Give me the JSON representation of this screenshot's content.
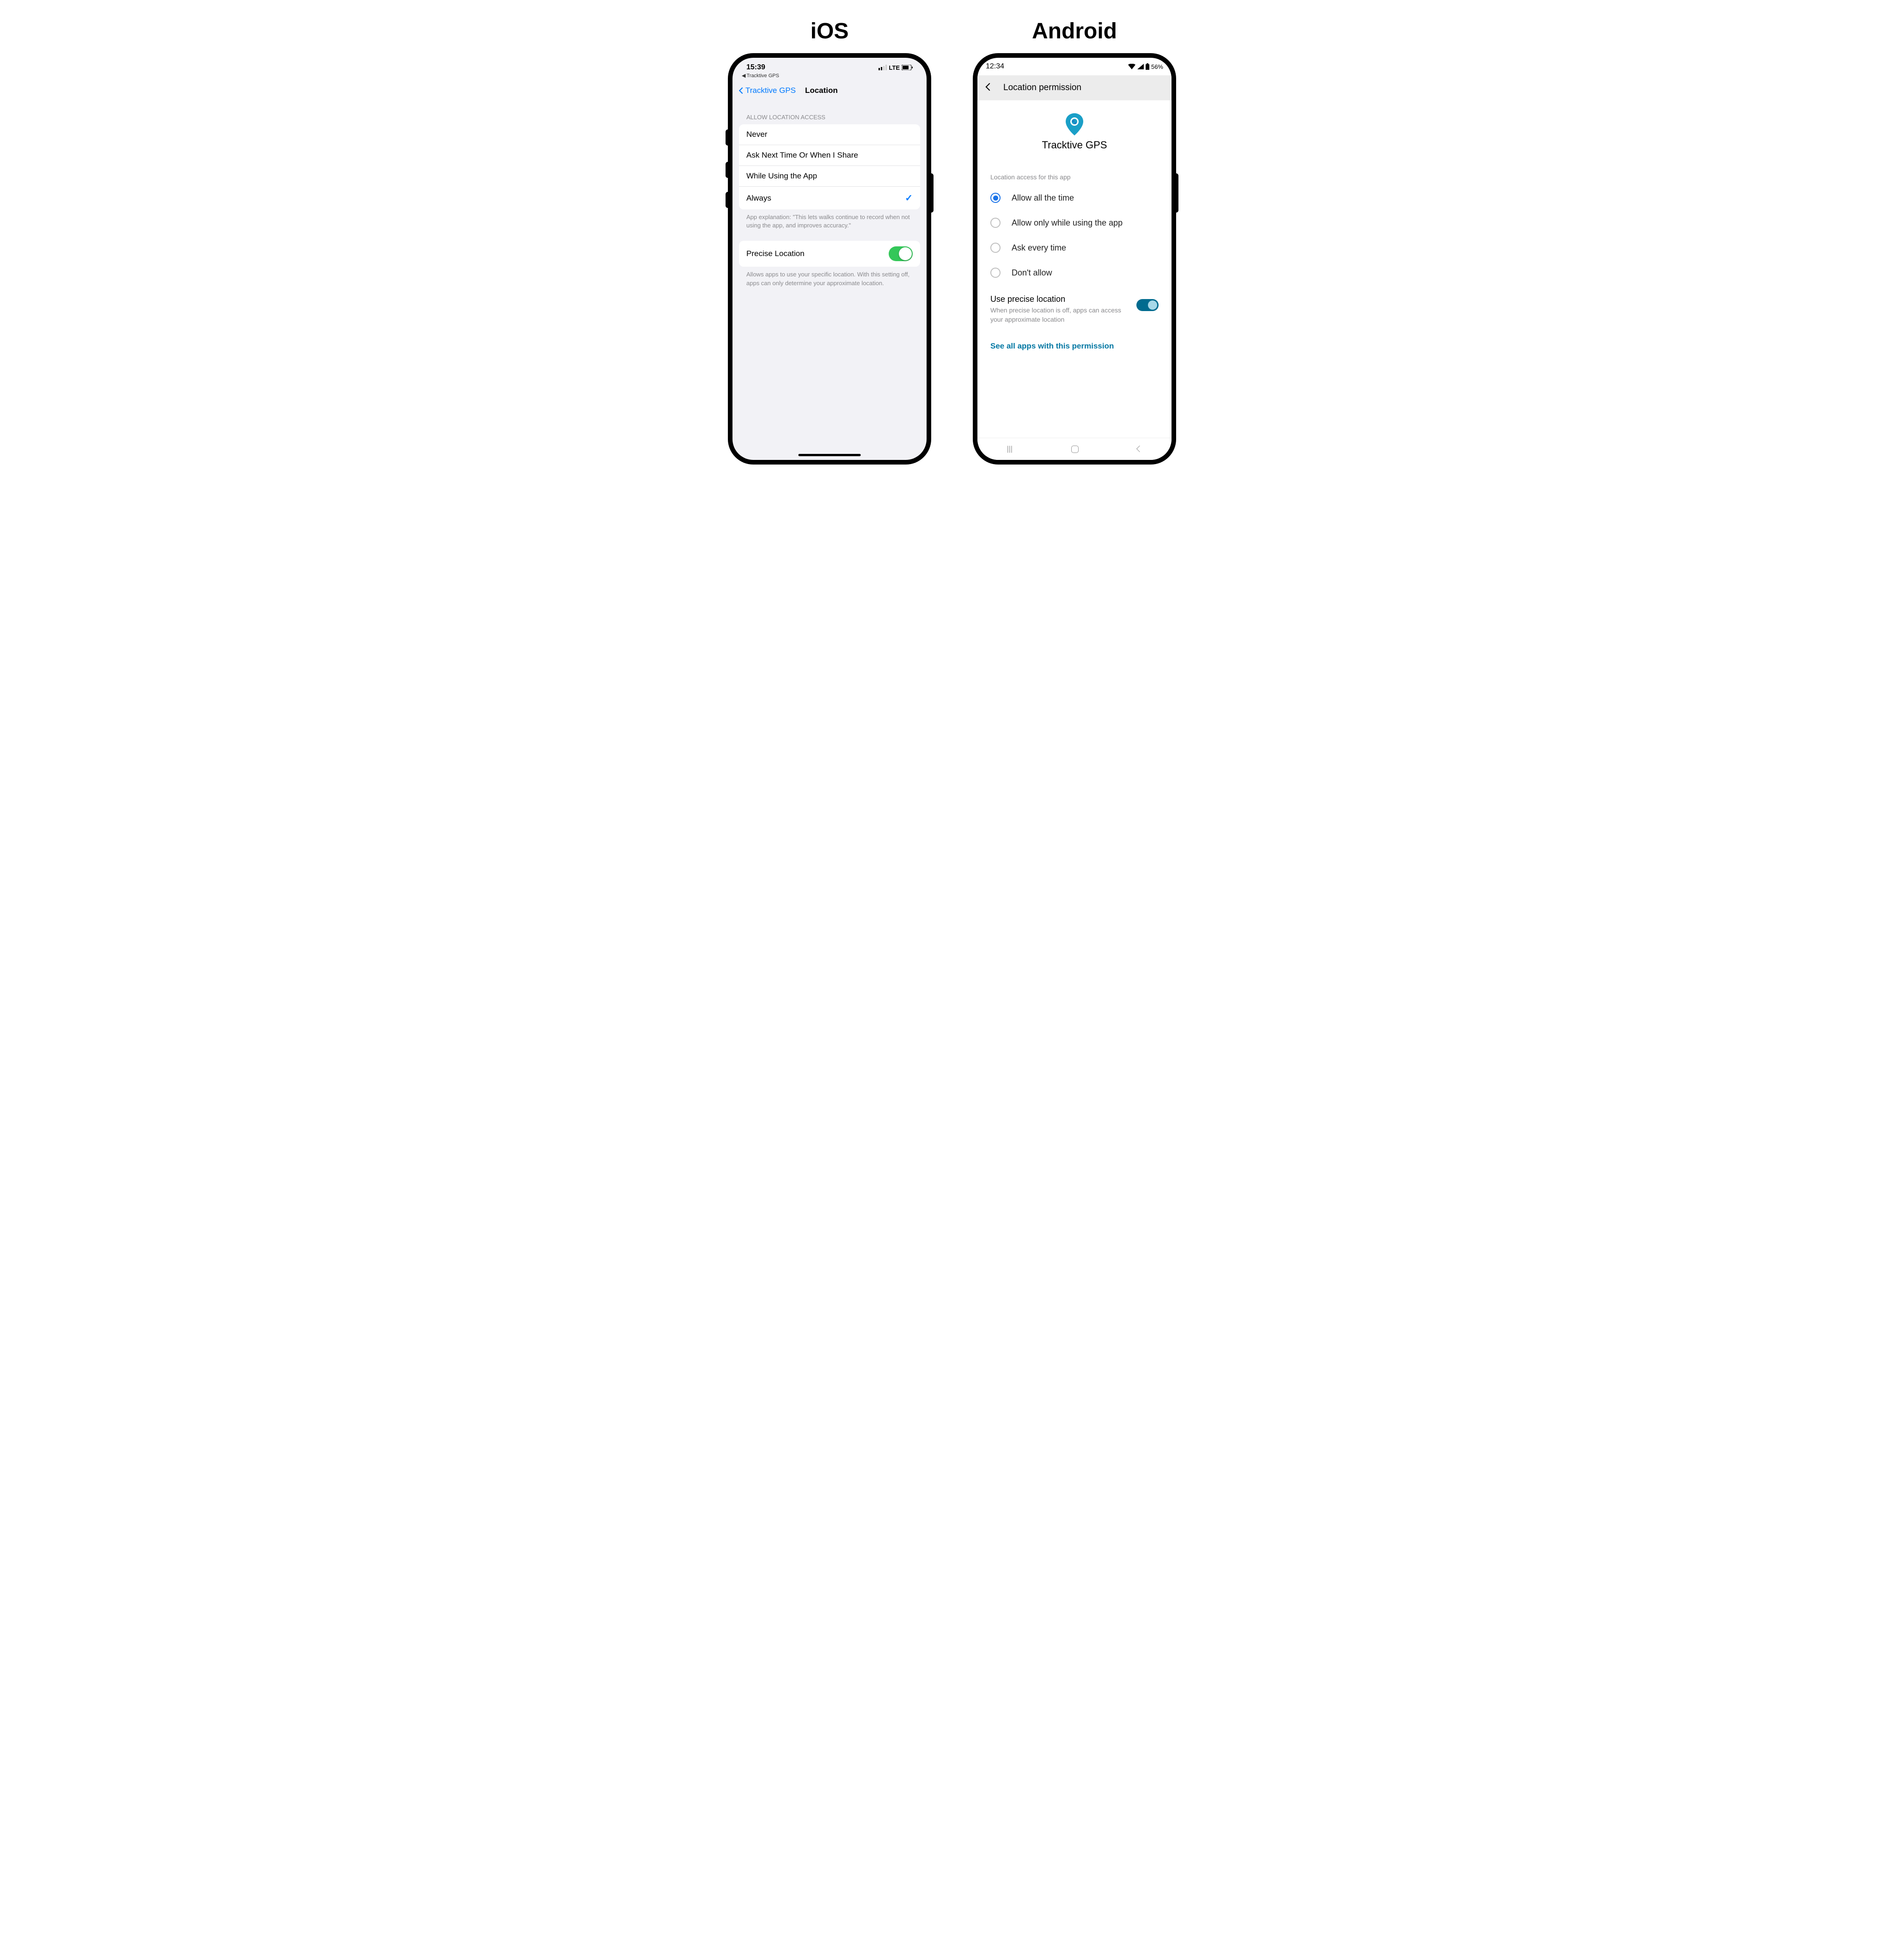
{
  "ios": {
    "heading": "iOS",
    "time": "15:39",
    "network": "LTE",
    "back_to": "Tracktive GPS",
    "nav_back": "Tracktive GPS",
    "nav_title": "Location",
    "section_header": "Allow Location Access",
    "options": [
      {
        "label": "Never",
        "selected": false
      },
      {
        "label": "Ask Next Time Or When I Share",
        "selected": false
      },
      {
        "label": "While Using the App",
        "selected": false
      },
      {
        "label": "Always",
        "selected": true
      }
    ],
    "explain": "App explanation: \"This lets walks continue to record when not using the app, and improves accuracy.\"",
    "precise_label": "Precise Location",
    "precise_on": true,
    "precise_desc": "Allows apps to use your specific location. With this setting off, apps can only determine your approximate location."
  },
  "android": {
    "heading": "Android",
    "time": "12:34",
    "battery": "56%",
    "header_title": "Location permission",
    "app_name": "Tracktive GPS",
    "section_header": "Location access for this app",
    "options": [
      {
        "label": "Allow all the time",
        "selected": true
      },
      {
        "label": "Allow only while using the app",
        "selected": false
      },
      {
        "label": "Ask every time",
        "selected": false
      },
      {
        "label": "Don't allow",
        "selected": false
      }
    ],
    "precise_title": "Use precise location",
    "precise_desc": "When precise location is off, apps can access your approximate location",
    "precise_on": true,
    "link": "See all apps with this permission"
  }
}
